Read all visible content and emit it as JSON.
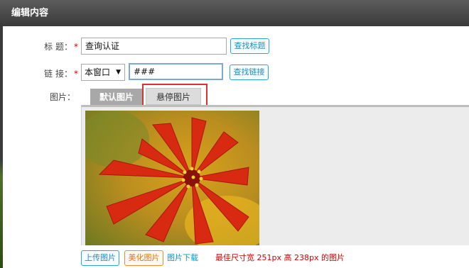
{
  "dialog": {
    "title": "编辑内容"
  },
  "form": {
    "title_label": "标 题：",
    "title_value": "查询认证",
    "find_title_button": "查找标题",
    "link_label": "链 接：",
    "target_select": "本窗口",
    "link_value": "###",
    "find_link_button": "查找链接",
    "image_label": "图片：",
    "required_mark": "*"
  },
  "tabs": [
    {
      "label": "默认图片",
      "active": true
    },
    {
      "label": "悬停图片",
      "active": false
    }
  ],
  "image_actions": {
    "upload_label": "上传图片",
    "beautify_label": "美化图片",
    "download_label": "图片下载",
    "size_hint": "最佳尺寸宽 251px 高 238px 的图片"
  },
  "colors": {
    "accent_blue": "#29a7cc",
    "accent_orange": "#f08a2b",
    "required_red": "#d40000",
    "highlight_red": "#e03030"
  },
  "icons": {
    "select_arrow": "triangle-down"
  }
}
